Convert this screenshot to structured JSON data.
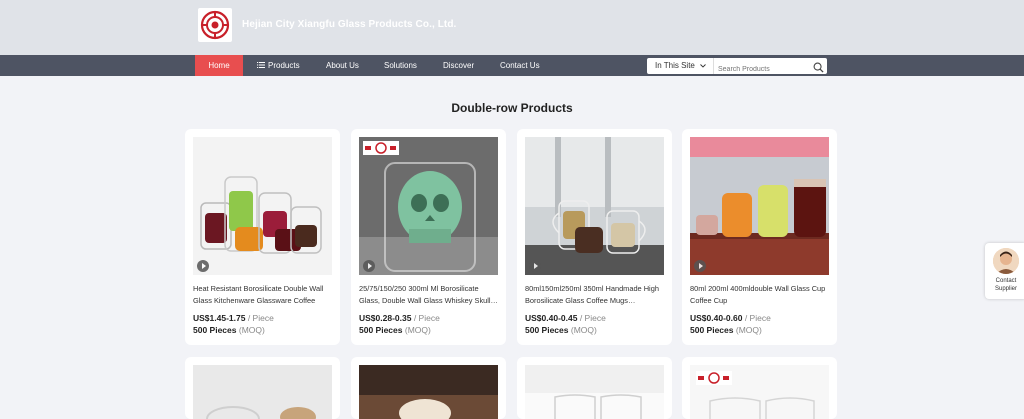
{
  "header": {
    "company_name": "Hejian City Xiangfu Glass Products Co., Ltd."
  },
  "nav": {
    "items": [
      "Home",
      "Products",
      "About Us",
      "Solutions",
      "Discover",
      "Contact Us"
    ],
    "site_select": "In This Site",
    "search_placeholder": "Search Products"
  },
  "section": {
    "title": "Double-row Products"
  },
  "products": [
    {
      "title": "Heat Resistant Borosilicate Double Wall Glass Kitchenware Glassware Coffee",
      "price": "US$1.45-1.75",
      "unit": "/ Piece",
      "moq": "500 Pieces",
      "moq_label": "(MOQ)"
    },
    {
      "title": "25/75/150/250 300ml Ml Borosilicate Glass, Double Wall Glass Whiskey Skull…",
      "price": "US$0.28-0.35",
      "unit": "/ Piece",
      "moq": "500 Pieces",
      "moq_label": "(MOQ)"
    },
    {
      "title": "80ml150ml250ml 350ml Handmade High Borosilicate Glass Coffee Mugs…",
      "price": "US$0.40-0.45",
      "unit": "/ Piece",
      "moq": "500 Pieces",
      "moq_label": "(MOQ)"
    },
    {
      "title": "80ml 200ml 400mldouble Wall Glass Cup Coffee Cup",
      "price": "US$0.40-0.60",
      "unit": "/ Piece",
      "moq": "500 Pieces",
      "moq_label": "(MOQ)"
    }
  ],
  "contact_supplier": {
    "line1": "Contact",
    "line2": "Supplier"
  },
  "colors": {
    "nav_bg": "#4e5463",
    "home_active": "#e84e4f",
    "header_bg": "#e0e3e8",
    "page_bg": "#f2f3f7"
  }
}
